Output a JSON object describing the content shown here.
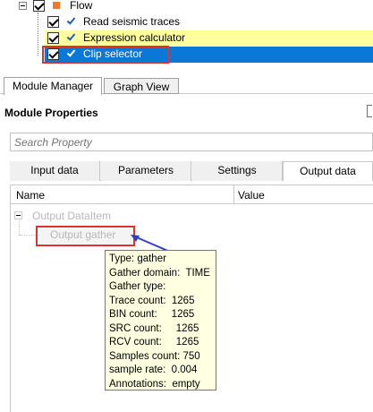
{
  "flow_tree": {
    "root_label": "Flow",
    "items": [
      {
        "label": "Read seismic traces"
      },
      {
        "label": "Expression calculator"
      },
      {
        "label": "Clip selector"
      }
    ]
  },
  "tabs": {
    "module_manager": "Module Manager",
    "graph_view": "Graph View"
  },
  "module_properties": {
    "title": "Module Properties",
    "search_placeholder": "Search Property",
    "tabs": [
      "Input data",
      "Parameters",
      "Settings",
      "Output data"
    ],
    "active_tab": "Output data",
    "columns": {
      "name": "Name",
      "value": "Value"
    },
    "tree": {
      "root": "Output DataItem",
      "child": "Output gather"
    }
  },
  "tooltip": {
    "lines": [
      "Type: gather",
      "Gather domain:  TIME",
      "Gather type:",
      "Trace count:  1265",
      "BIN count:     1265",
      "SRC count:     1265",
      "RCV count:     1265",
      "Samples count: 750",
      "sample rate:  0.004",
      "Annotations:  empty"
    ]
  },
  "colors": {
    "selection_blue": "#0a78d7",
    "highlight_yellow": "#ffff9e",
    "annotation_red": "#e03030",
    "arrow_blue": "#2f3fbf",
    "tooltip_bg": "#ffffe1"
  }
}
